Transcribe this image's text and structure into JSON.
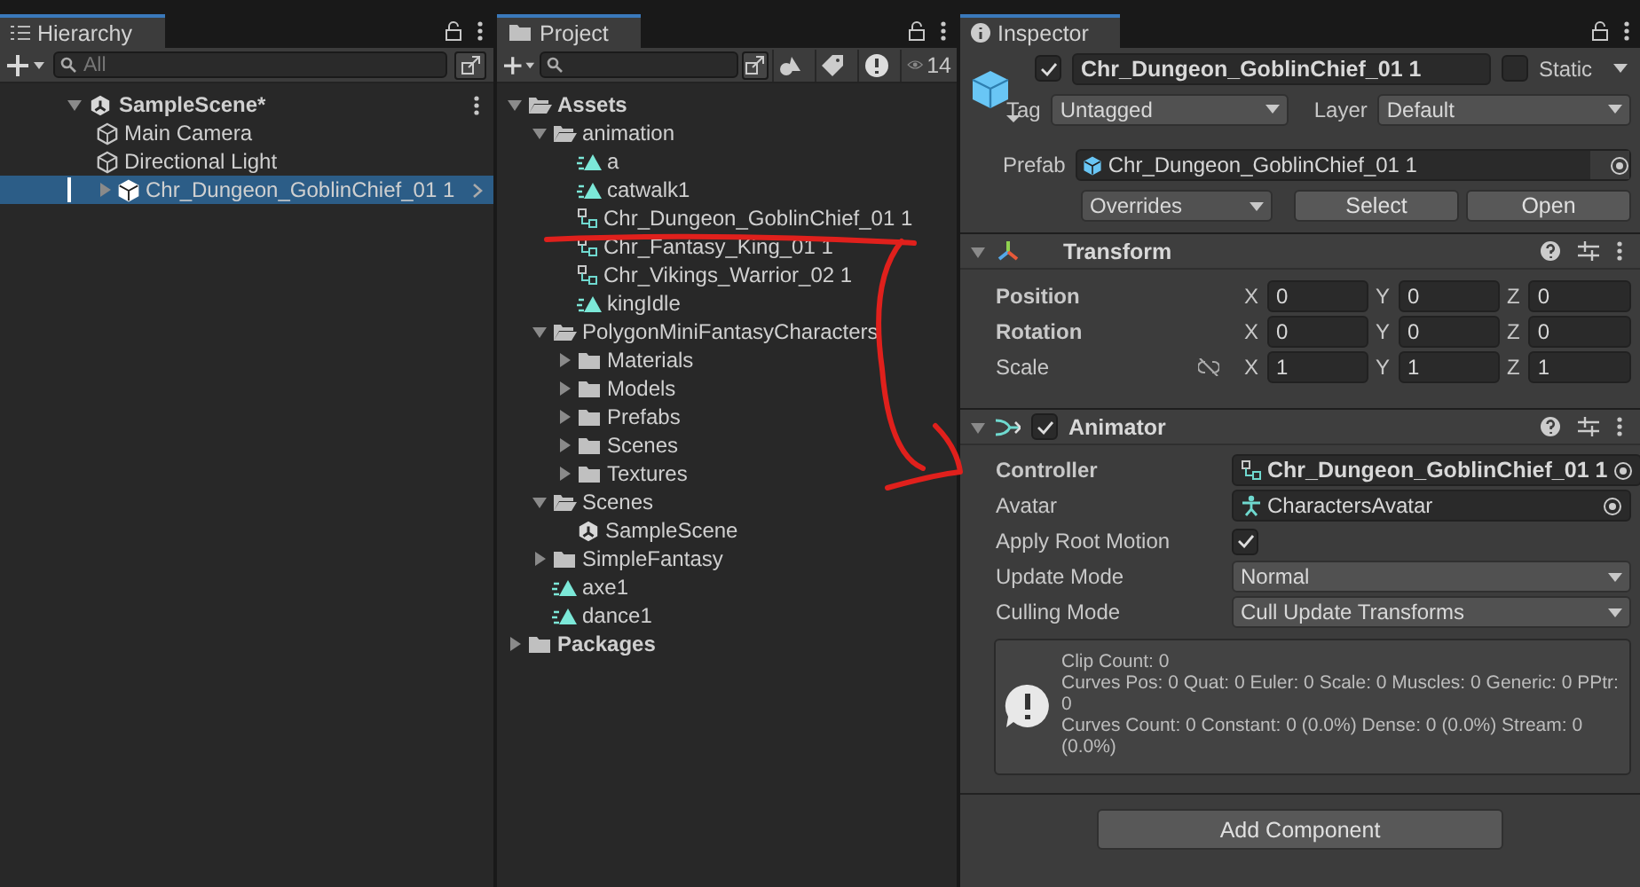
{
  "hierarchy": {
    "tab": "Hierarchy",
    "search": {
      "placeholder": "All"
    },
    "scene": {
      "name": "SampleScene*",
      "expanded": true,
      "children": [
        {
          "name": "Main Camera",
          "selected": false,
          "has_children": false
        },
        {
          "name": "Directional Light",
          "selected": false,
          "has_children": false
        },
        {
          "name": "Chr_Dungeon_GoblinChief_01 1",
          "selected": true,
          "has_children": true
        }
      ]
    }
  },
  "project": {
    "tab": "Project",
    "count": "14",
    "tree": [
      {
        "name": "Assets",
        "kind": "folder",
        "bold": true,
        "expanded": true,
        "children": [
          {
            "name": "animation",
            "kind": "folder",
            "bold": false,
            "expanded": true,
            "children": [
              {
                "name": "a",
                "kind": "clip"
              },
              {
                "name": "catwalk1",
                "kind": "clip"
              },
              {
                "name": "Chr_Dungeon_GoblinChief_01 1",
                "kind": "controller"
              },
              {
                "name": "Chr_Fantasy_King_01 1",
                "kind": "controller"
              },
              {
                "name": "Chr_Vikings_Warrior_02 1",
                "kind": "controller"
              },
              {
                "name": "kingIdle",
                "kind": "clip"
              }
            ]
          },
          {
            "name": "PolygonMiniFantasyCharacters",
            "kind": "folder",
            "bold": false,
            "expanded": true,
            "children": [
              {
                "name": "Materials",
                "kind": "folder",
                "bold": false,
                "expanded": false
              },
              {
                "name": "Models",
                "kind": "folder",
                "bold": false,
                "expanded": false
              },
              {
                "name": "Prefabs",
                "kind": "folder",
                "bold": false,
                "expanded": false
              },
              {
                "name": "Scenes",
                "kind": "folder",
                "bold": false,
                "expanded": false
              },
              {
                "name": "Textures",
                "kind": "folder",
                "bold": false,
                "expanded": false
              }
            ]
          },
          {
            "name": "Scenes",
            "kind": "folder",
            "bold": false,
            "expanded": true,
            "children": [
              {
                "name": "SampleScene",
                "kind": "scene"
              }
            ]
          },
          {
            "name": "SimpleFantasy",
            "kind": "folder",
            "bold": false,
            "expanded": false
          },
          {
            "name": "axe1",
            "kind": "clip"
          },
          {
            "name": "dance1",
            "kind": "clip"
          }
        ]
      },
      {
        "name": "Packages",
        "kind": "folder",
        "bold": true,
        "expanded": false
      }
    ]
  },
  "inspector": {
    "tab": "Inspector",
    "object": {
      "active": true,
      "name": "Chr_Dungeon_GoblinChief_01 1",
      "static": false,
      "static_label": "Static",
      "tag_label": "Tag",
      "tag": "Untagged",
      "layer_label": "Layer",
      "layer": "Default",
      "prefab_label": "Prefab",
      "prefab": "Chr_Dungeon_GoblinChief_01 1",
      "overrides": "Overrides",
      "buttons": [
        "Select",
        "Open"
      ]
    },
    "transform": {
      "title": "Transform",
      "expanded": true,
      "rows": [
        {
          "label": "Position",
          "overridden": true,
          "values": [
            {
              "axis": "X",
              "value": "0"
            },
            {
              "axis": "Y",
              "value": "0"
            },
            {
              "axis": "Z",
              "value": "0"
            }
          ]
        },
        {
          "label": "Rotation",
          "overridden": true,
          "values": [
            {
              "axis": "X",
              "value": "0"
            },
            {
              "axis": "Y",
              "value": "0"
            },
            {
              "axis": "Z",
              "value": "0"
            }
          ]
        },
        {
          "label": "Scale",
          "overridden": false,
          "values": [
            {
              "axis": "X",
              "value": "1"
            },
            {
              "axis": "Y",
              "value": "1"
            },
            {
              "axis": "Z",
              "value": "1"
            }
          ]
        }
      ]
    },
    "animator": {
      "title": "Animator",
      "expanded": true,
      "enabled": true,
      "fields": [
        {
          "label": "Controller",
          "kind": "controller",
          "overridden": true,
          "value": "Chr_Dungeon_GoblinChief_01 1"
        },
        {
          "label": "Avatar",
          "kind": "avatar",
          "overridden": false,
          "value": "CharactersAvatar"
        },
        {
          "label": "Apply Root Motion",
          "kind": "checkbox",
          "overridden": false,
          "checked": true
        },
        {
          "label": "Update Mode",
          "kind": "dropdown",
          "overridden": false,
          "value": "Normal"
        },
        {
          "label": "Culling Mode",
          "kind": "dropdown",
          "overridden": false,
          "value": "Cull Update Transforms"
        }
      ],
      "info": [
        "Clip Count: 0",
        "Curves Pos: 0 Quat: 0 Euler: 0 Scale: 0 Muscles: 0 Generic: 0 PPtr: 0",
        "Curves Count: 0 Constant: 0 (0.0%) Dense: 0 (0.0%) Stream: 0 (0.0%)"
      ]
    },
    "add_component": "Add Component"
  }
}
